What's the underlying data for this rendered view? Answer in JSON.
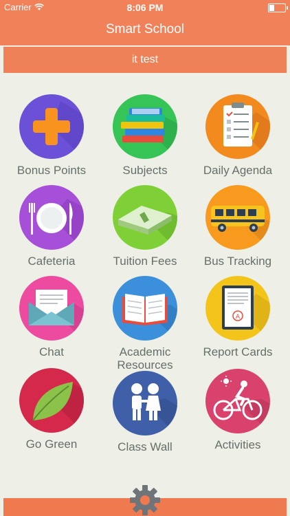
{
  "status_bar": {
    "carrier": "Carrier",
    "time": "8:06 PM"
  },
  "nav": {
    "title": "Smart School"
  },
  "subheader": {
    "text": "it test"
  },
  "tiles": [
    {
      "label": "Bonus Points"
    },
    {
      "label": "Subjects"
    },
    {
      "label": "Daily Agenda"
    },
    {
      "label": "Cafeteria"
    },
    {
      "label": "Tuition Fees"
    },
    {
      "label": "Bus Tracking"
    },
    {
      "label": "Chat"
    },
    {
      "label": "Academic Resources"
    },
    {
      "label": "Report Cards"
    },
    {
      "label": "Go Green"
    },
    {
      "label": "Class Wall"
    },
    {
      "label": "Activities"
    }
  ],
  "colors": {
    "brand": "#f08158",
    "background": "#eef0e8",
    "label": "#666e6a"
  }
}
